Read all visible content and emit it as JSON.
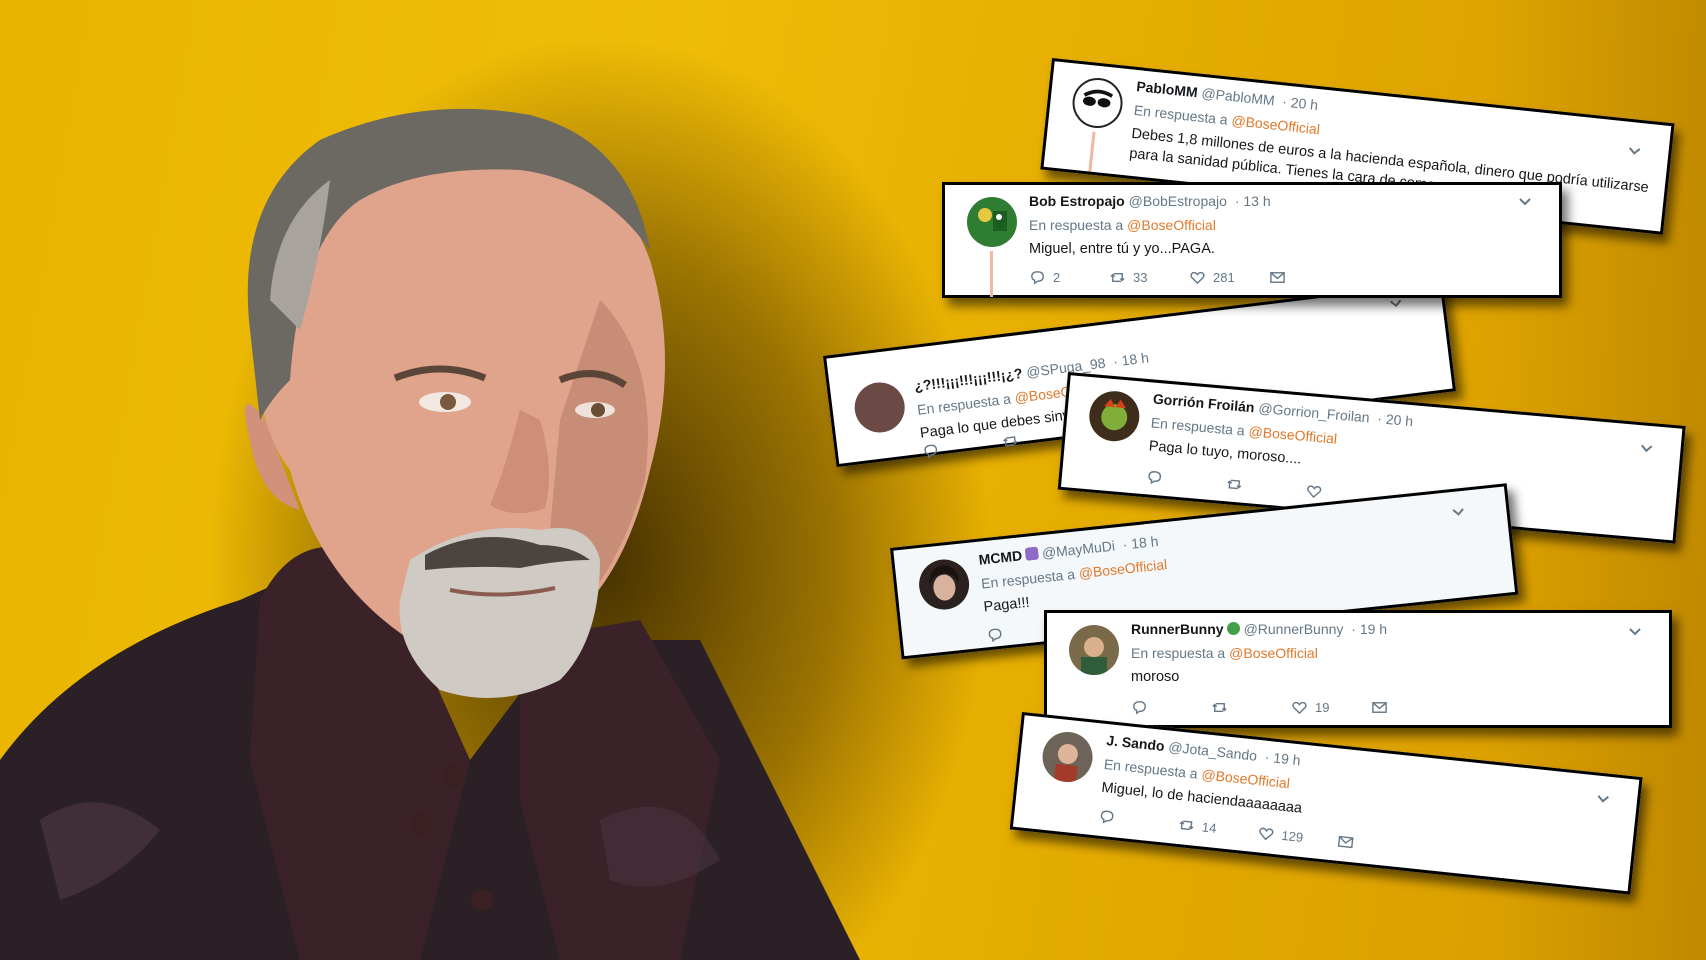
{
  "colors": {
    "background": "#e9b200",
    "link": "#e0792b",
    "meta": "#657786"
  },
  "tweets": [
    {
      "name": "PabloMM",
      "handle": "@PabloMM",
      "time": "· 20 h",
      "reply_prefix": "En respuesta a",
      "mention": "@BoseOfficial",
      "text": "Debes 1,8 millones de euros a la hacienda española, dinero que podría utilizarse",
      "text2": "para la sanidad pública. Tienes la cara de cemen..."
    },
    {
      "name": "Bob Estropajo",
      "handle": "@BobEstropajo",
      "time": "· 13 h",
      "reply_prefix": "En respuesta a",
      "mention": "@BoseOfficial",
      "text": "Miguel, entre tú y yo...PAGA.",
      "replies": "2",
      "retweets": "33",
      "likes": "281"
    },
    {
      "name": "¿?!!!¡¡¡!!!¡¡¡!!!¡¿?",
      "handle": "@SPuga_98",
      "time": "· 18 h",
      "reply_prefix": "En respuesta a",
      "mention": "@BoseOfficial",
      "text": "Paga lo que debes sinve"
    },
    {
      "name": "Gorrión Froilán",
      "handle": "@Gorrion_Froilan",
      "time": "· 20 h",
      "reply_prefix": "En respuesta a",
      "mention": "@BoseOfficial",
      "text": "Paga lo tuyo, moroso...."
    },
    {
      "name": "MCMD",
      "handle": "@MayMuDi",
      "time": "· 18 h",
      "reply_prefix": "En respuesta a",
      "mention": "@BoseOfficial",
      "text": "Paga!!!"
    },
    {
      "name": "RunnerBunny",
      "handle": "@RunnerBunny",
      "time": "· 19 h",
      "reply_prefix": "En respuesta a",
      "mention": "@BoseOfficial",
      "text": "moroso",
      "likes": "19"
    },
    {
      "name": "J. Sando",
      "handle": "@Jota_Sando",
      "time": "· 19 h",
      "reply_prefix": "En respuesta a",
      "mention": "@BoseOfficial",
      "text": "Miguel, lo de haciendaaaaaaaa",
      "retweets": "14",
      "likes": "129"
    }
  ],
  "icons": {
    "reply": "reply-icon",
    "retweet": "retweet-icon",
    "like": "heart-icon",
    "dm": "mail-icon",
    "menu": "chevron-down-icon"
  }
}
